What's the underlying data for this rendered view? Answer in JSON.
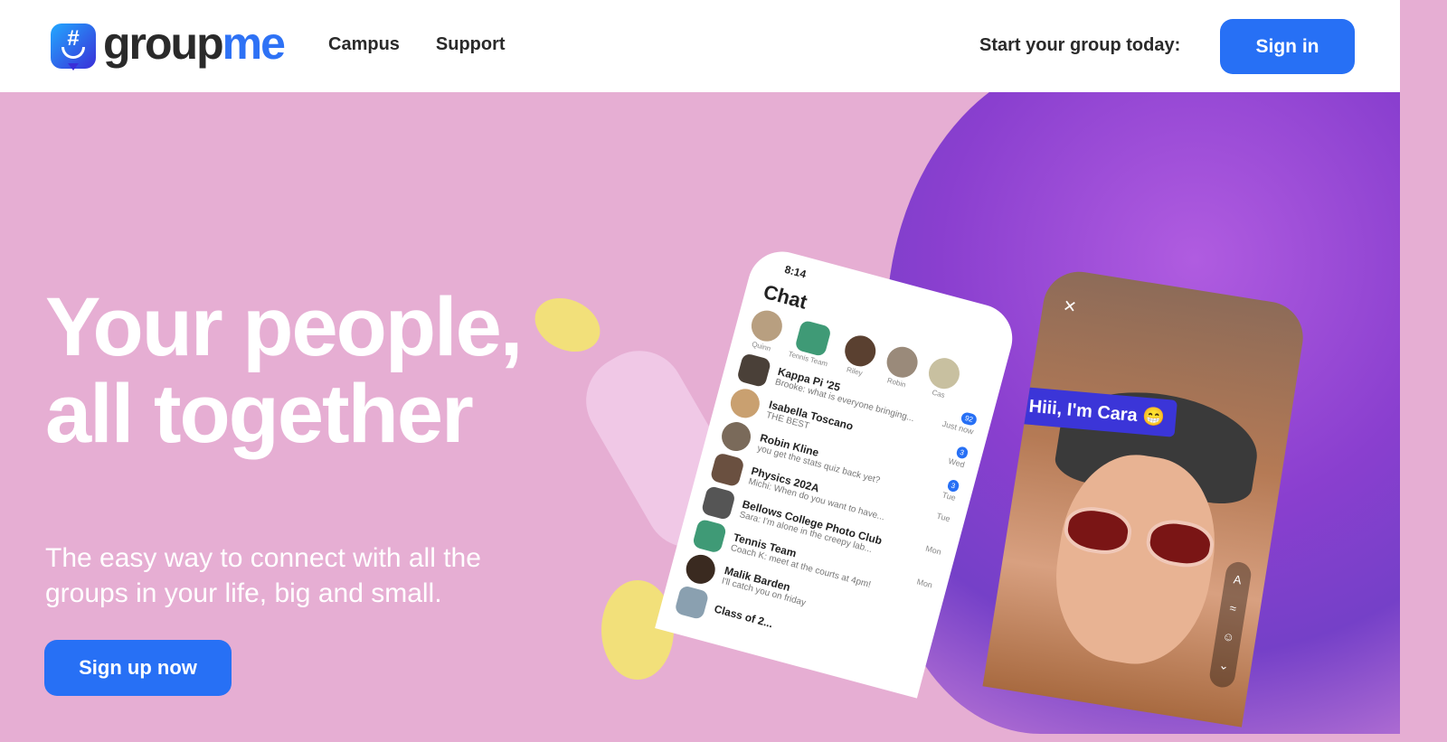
{
  "header": {
    "logo_text_main": "group",
    "logo_text_accent": "me",
    "logo_symbol": "#",
    "nav": [
      "Campus",
      "Support"
    ],
    "cta_text": "Start your group today:",
    "signin_label": "Sign in"
  },
  "hero": {
    "headline": "Your people, all together",
    "subtitle": "The easy way to connect with all the groups in your life, big and small.",
    "signup_label": "Sign up now"
  },
  "phone": {
    "time": "8:14",
    "title": "Chat",
    "stories": [
      "Quinn",
      "Tennis Team",
      "Riley",
      "Robin",
      "Cas"
    ],
    "chats": [
      {
        "name": "Kappa Pi '25",
        "preview": "Brooke: what is everyone bringing...",
        "time": "Just now",
        "badge": "92"
      },
      {
        "name": "Isabella Toscano",
        "preview": "THE BEST",
        "time": "Wed",
        "badge": "3"
      },
      {
        "name": "Robin Kline",
        "preview": "you get the stats quiz back yet?",
        "time": "Tue",
        "badge": "3"
      },
      {
        "name": "Physics 202A",
        "preview": "Michi: When do you want to have...",
        "time": "Tue",
        "badge": ""
      },
      {
        "name": "Bellows College Photo Club",
        "preview": "Sara: I'm alone in the creepy lab...",
        "time": "Mon",
        "badge": ""
      },
      {
        "name": "Tennis Team",
        "preview": "Coach K: meet at the courts at 4pm!",
        "time": "Mon",
        "badge": ""
      },
      {
        "name": "Malik Barden",
        "preview": "I'll catch you on friday",
        "time": "",
        "badge": ""
      },
      {
        "name": "Class of 2...",
        "preview": "",
        "time": "",
        "badge": ""
      }
    ]
  },
  "photo": {
    "caption": "Hiii, I'm Cara 😁",
    "tools": [
      "A",
      "≈",
      "☺",
      "⌄"
    ]
  },
  "colors": {
    "accent": "#2770f5",
    "hero_bg": "#e6aed3"
  }
}
